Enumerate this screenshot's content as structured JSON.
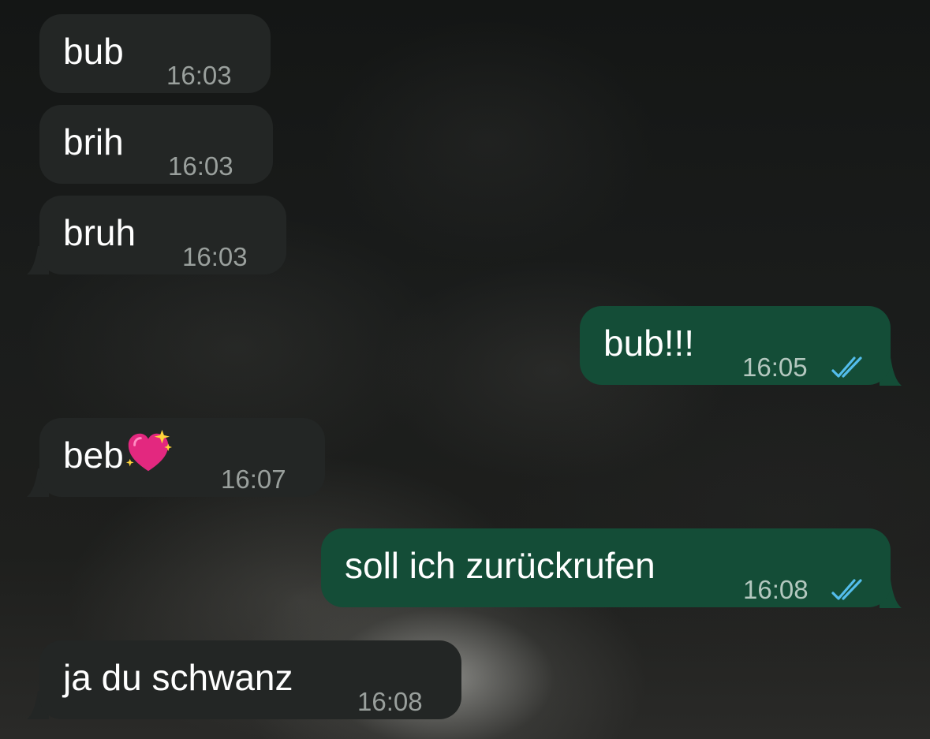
{
  "messages": [
    {
      "direction": "incoming",
      "text": "bub",
      "time": "16:03"
    },
    {
      "direction": "incoming",
      "text": "brih",
      "time": "16:03"
    },
    {
      "direction": "incoming",
      "text": "bruh",
      "time": "16:03"
    },
    {
      "direction": "outgoing",
      "text": "bub!!!",
      "time": "16:05",
      "status": "read"
    },
    {
      "direction": "incoming",
      "text": "beb",
      "emoji": "sparkling-heart",
      "time": "16:07"
    },
    {
      "direction": "outgoing",
      "text": "soll ich zurückrufen",
      "time": "16:08",
      "status": "read"
    },
    {
      "direction": "incoming",
      "text": "ja du schwanz",
      "time": "16:08"
    }
  ],
  "colors": {
    "incoming_bubble": "#232625",
    "outgoing_bubble": "#144d37",
    "read_ticks": "#53bdeb"
  }
}
